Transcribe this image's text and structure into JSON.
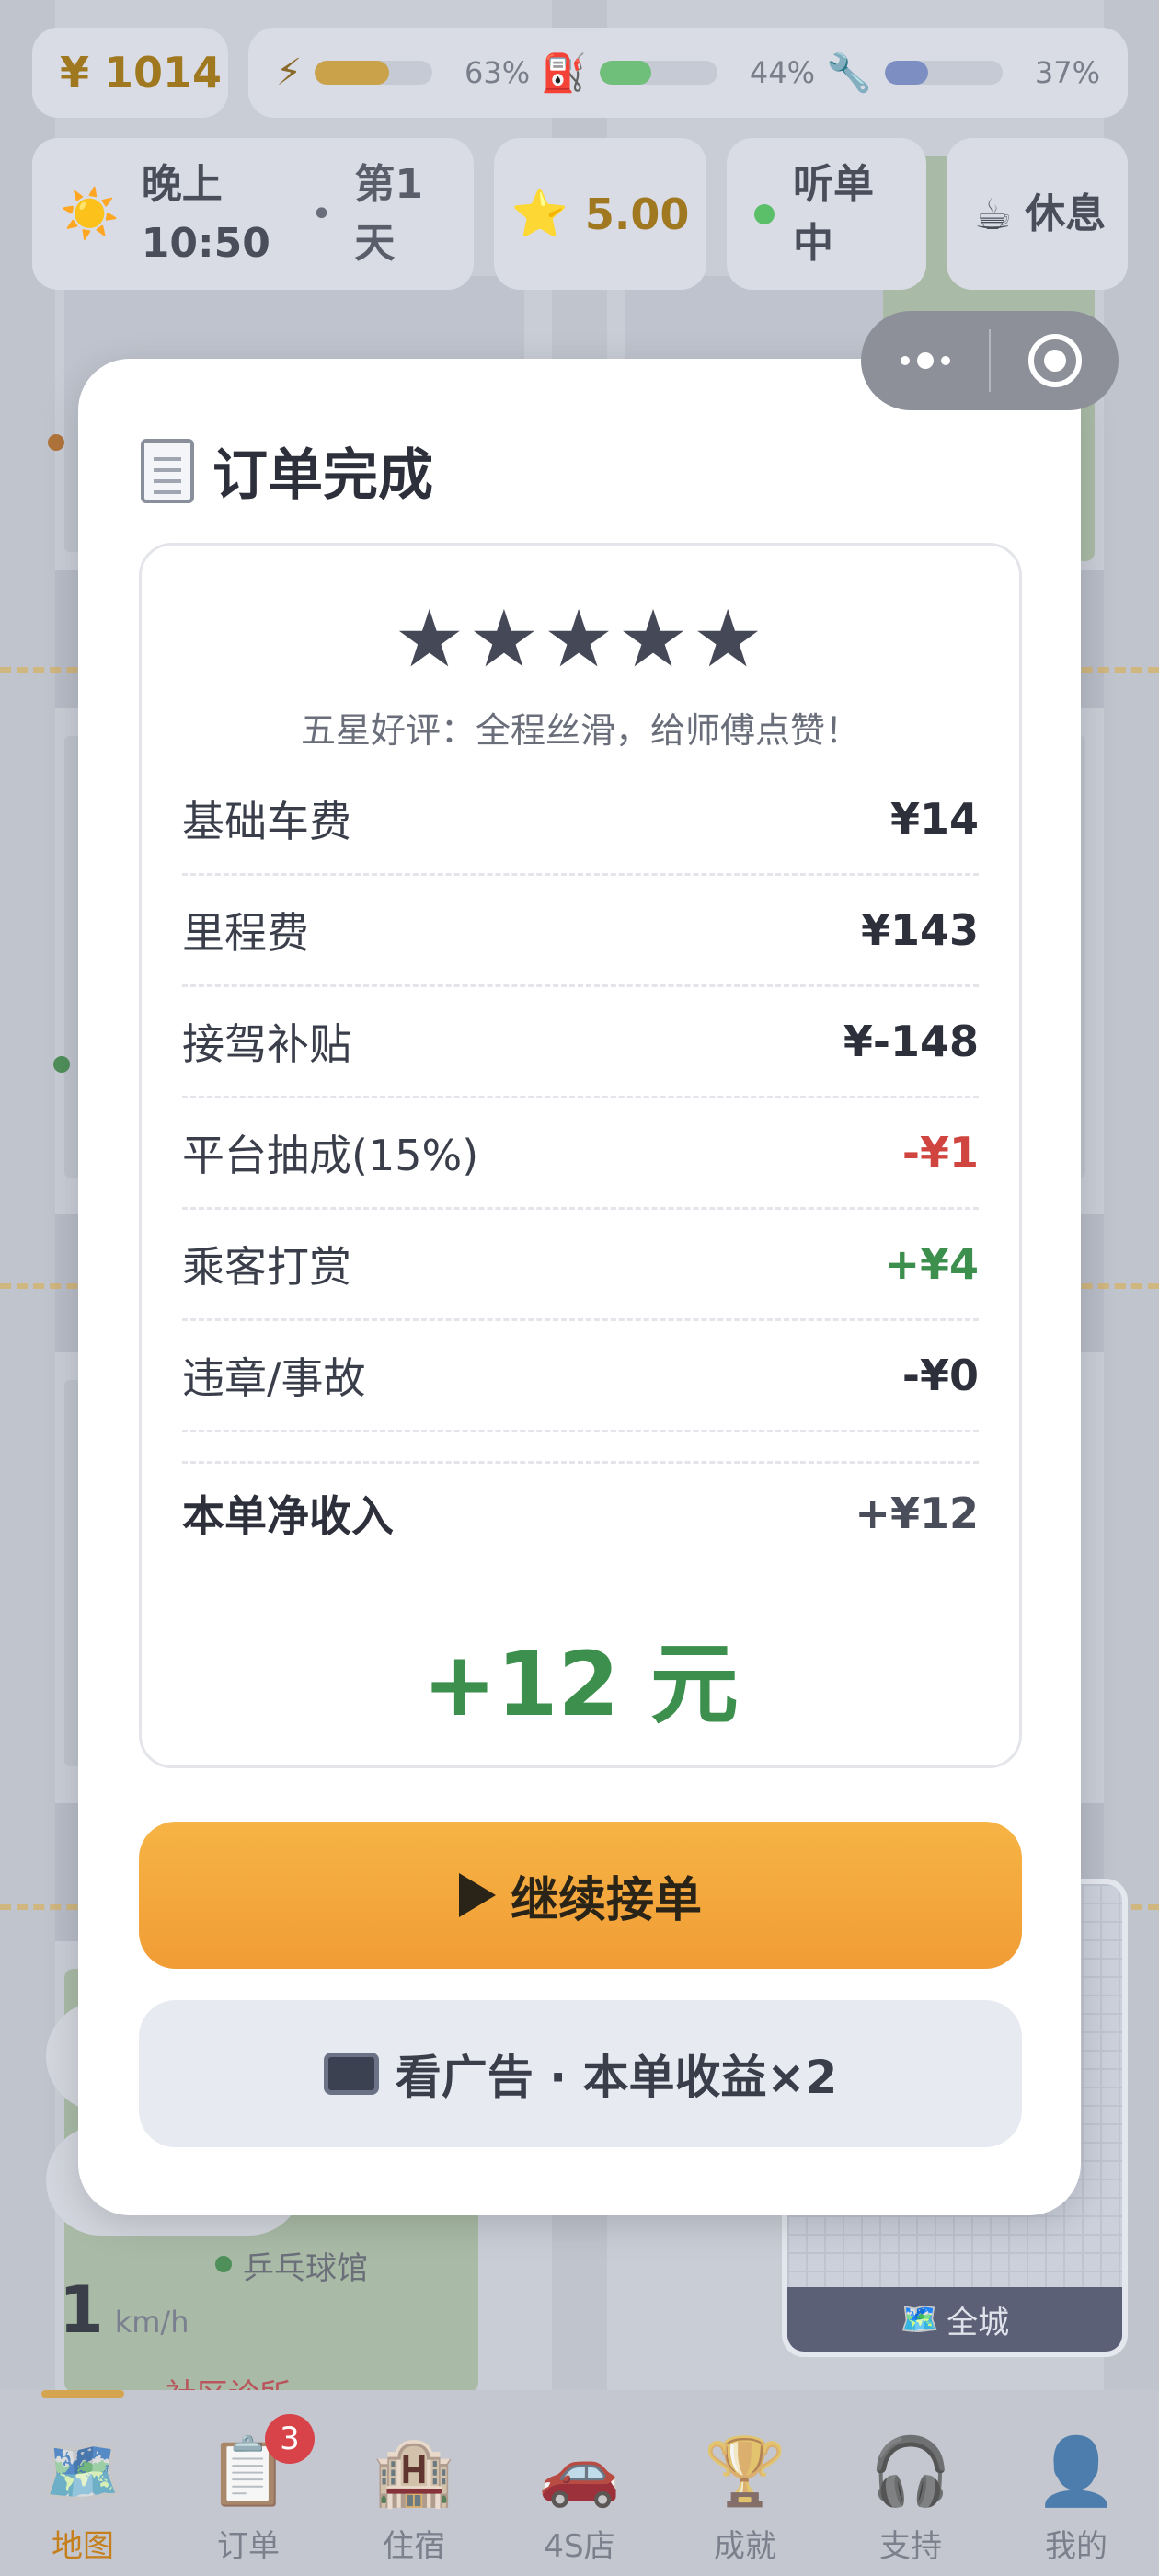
{
  "hud": {
    "money": "¥ 1014",
    "meters": [
      {
        "icon": "⚡",
        "name": "energy",
        "value": "63%",
        "fraction": 0.63,
        "color": "#c9a24a"
      },
      {
        "icon": "⛽",
        "name": "fuel",
        "value": "44%",
        "fraction": 0.44,
        "color": "#6fbf7a"
      },
      {
        "icon": "🔧",
        "name": "repair",
        "value": "37%",
        "fraction": 0.37,
        "color": "#7d8fc2"
      }
    ],
    "time": "晚上 10:50",
    "day": "第1天",
    "rating": "5.00",
    "status": "听单中",
    "rest": "休息"
  },
  "modal": {
    "title": "订单完成",
    "stars": "★★★★★",
    "review": "五星好评：全程丝滑，给师傅点赞！",
    "rows": [
      {
        "label": "基础车费",
        "value": "¥14",
        "tone": "normal"
      },
      {
        "label": "里程费",
        "value": "¥143",
        "tone": "normal"
      },
      {
        "label": "接驾补贴",
        "value": "¥-148",
        "tone": "normal"
      },
      {
        "label": "平台抽成(15%)",
        "value": "-¥1",
        "tone": "neg"
      },
      {
        "label": "乘客打赏",
        "value": "+¥4",
        "tone": "pos"
      },
      {
        "label": "违章/事故",
        "value": "-¥0",
        "tone": "normal"
      }
    ],
    "net_label": "本单净收入",
    "net_value": "+¥12",
    "net_big": "+12 元",
    "continue_button": "继续接单",
    "ad_button": "看广告 · 本单收益×2"
  },
  "map": {
    "speed_value": "1",
    "speed_unit": "km/h",
    "poi_1": "乒乓球馆",
    "poi_2": "社区诊所",
    "minimap_label": "全城"
  },
  "tabs": [
    {
      "icon": "🗺️",
      "label": "地图",
      "active": true
    },
    {
      "icon": "📋",
      "label": "订单",
      "badge": "3"
    },
    {
      "icon": "🏨",
      "label": "住宿"
    },
    {
      "icon": "🚗",
      "label": "4S店"
    },
    {
      "icon": "🏆",
      "label": "成就"
    },
    {
      "icon": "🎧",
      "label": "支持"
    },
    {
      "icon": "👤",
      "label": "我的"
    }
  ]
}
